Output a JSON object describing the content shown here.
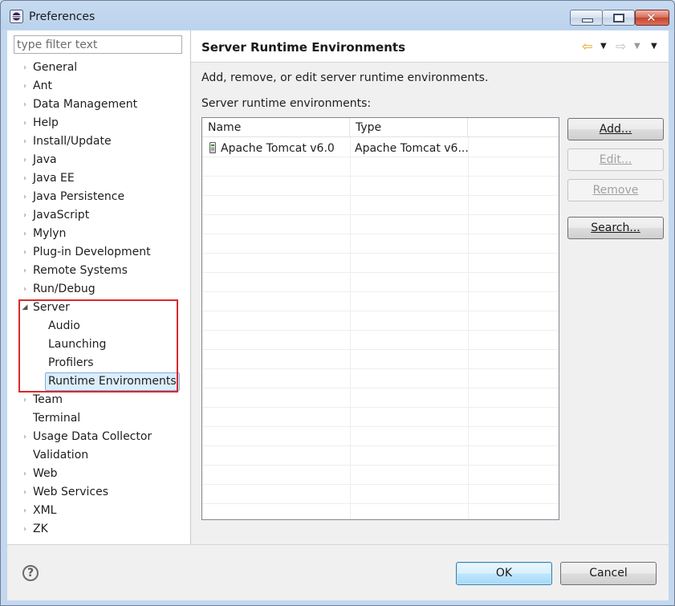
{
  "window": {
    "title": "Preferences"
  },
  "filter": {
    "placeholder": "type filter text"
  },
  "tree": [
    {
      "label": "General",
      "expandable": true
    },
    {
      "label": "Ant",
      "expandable": true
    },
    {
      "label": "Data Management",
      "expandable": true
    },
    {
      "label": "Help",
      "expandable": true
    },
    {
      "label": "Install/Update",
      "expandable": true
    },
    {
      "label": "Java",
      "expandable": true
    },
    {
      "label": "Java EE",
      "expandable": true
    },
    {
      "label": "Java Persistence",
      "expandable": true
    },
    {
      "label": "JavaScript",
      "expandable": true
    },
    {
      "label": "Mylyn",
      "expandable": true
    },
    {
      "label": "Plug-in Development",
      "expandable": true
    },
    {
      "label": "Remote Systems",
      "expandable": true
    },
    {
      "label": "Run/Debug",
      "expandable": true
    },
    {
      "label": "Server",
      "expandable": true,
      "expanded": true
    },
    {
      "label": "Audio",
      "child": true
    },
    {
      "label": "Launching",
      "child": true
    },
    {
      "label": "Profilers",
      "child": true
    },
    {
      "label": "Runtime Environments",
      "child": true,
      "selected": true
    },
    {
      "label": "Team",
      "expandable": true
    },
    {
      "label": "Terminal",
      "expandable": false
    },
    {
      "label": "Usage Data Collector",
      "expandable": true
    },
    {
      "label": "Validation",
      "expandable": false
    },
    {
      "label": "Web",
      "expandable": true
    },
    {
      "label": "Web Services",
      "expandable": true
    },
    {
      "label": "XML",
      "expandable": true
    },
    {
      "label": "ZK",
      "expandable": true
    }
  ],
  "page": {
    "title": "Server Runtime Environments",
    "description": "Add, remove, or edit server runtime environments.",
    "list_label": "Server runtime environments:"
  },
  "table": {
    "columns": [
      "Name",
      "Type"
    ],
    "rows": [
      {
        "name": "Apache Tomcat v6.0",
        "type": "Apache Tomcat v6..."
      }
    ]
  },
  "buttons": {
    "add": "Add...",
    "edit": "Edit...",
    "remove": "Remove",
    "search": "Search...",
    "ok": "OK",
    "cancel": "Cancel"
  },
  "icons": {
    "help": "?",
    "back": "⇦",
    "forward": "⇨",
    "dropdown": "▼",
    "expand": "›",
    "expanded": "◢"
  },
  "colors": {
    "highlight_border": "#d9292a",
    "selection_bg": "#dbeefc",
    "back_arrow": "#e2a41a"
  }
}
